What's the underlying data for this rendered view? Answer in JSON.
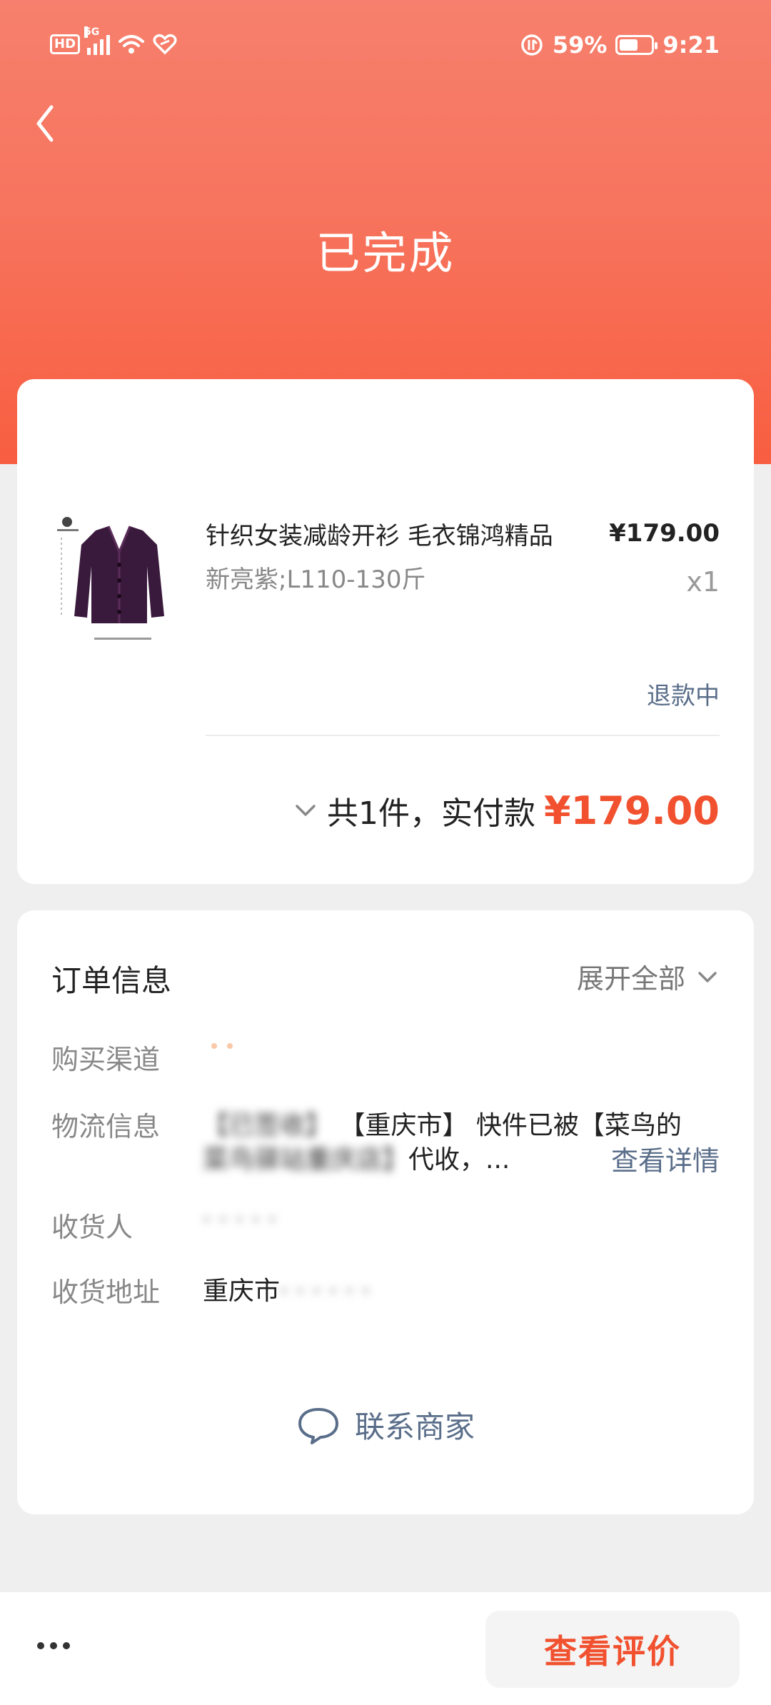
{
  "status_bar": {
    "hd": "HD",
    "network": "5G",
    "battery": "59%",
    "battery_level": 0.59,
    "time": "9:21"
  },
  "header": {
    "title": "已完成"
  },
  "product": {
    "name": "针织女装减龄开衫 毛衣锦鸿精品",
    "price": "¥179.00",
    "spec": "新亮紫;L110-130斤",
    "quantity": "x1",
    "refund_status": "退款中"
  },
  "summary": {
    "label": "共1件，实付款",
    "total": "¥179.00"
  },
  "order_info": {
    "title": "订单信息",
    "expand_label": "展开全部",
    "purchase_channel_label": "购买渠道",
    "logistics_label": "物流信息",
    "logistics_line1": "【重庆市】 快件已被【菜鸟的",
    "logistics_line2": "代收，...",
    "logistics_detail": "查看详情",
    "recipient_label": "收货人",
    "address_label": "收货地址",
    "address_value": "重庆市",
    "contact_label": "联系商家"
  },
  "bottom_bar": {
    "review_button": "查看评价"
  },
  "colors": {
    "accent": "#f1512f",
    "link": "#5a6e8a",
    "header_top": "#f6806d",
    "header_bottom": "#f85e40"
  }
}
